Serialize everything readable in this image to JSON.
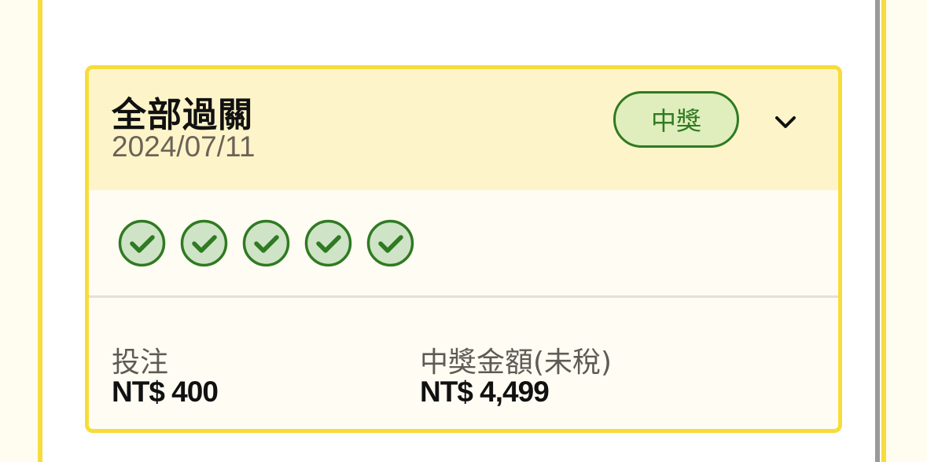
{
  "colors": {
    "card_border": "#f7dc3a",
    "header_background": "#fdf5c9",
    "win_green": "#2f7a22",
    "win_badge_fill": "#dfeebc",
    "check_fill": "#cfe3c6"
  },
  "bet_card": {
    "bet_type": "全部過關",
    "date": "2024/07/11",
    "status_badge": "中獎",
    "expand_icon": "chevron-down-icon",
    "legs": [
      {
        "icon": "check-circle-icon",
        "status": "won"
      },
      {
        "icon": "check-circle-icon",
        "status": "won"
      },
      {
        "icon": "check-circle-icon",
        "status": "won"
      },
      {
        "icon": "check-circle-icon",
        "status": "won"
      },
      {
        "icon": "check-circle-icon",
        "status": "won"
      }
    ],
    "stake": {
      "label": "投注",
      "value": "NT$ 400"
    },
    "payout": {
      "label": "中獎金額(未稅)",
      "value": "NT$ 4,499"
    }
  }
}
